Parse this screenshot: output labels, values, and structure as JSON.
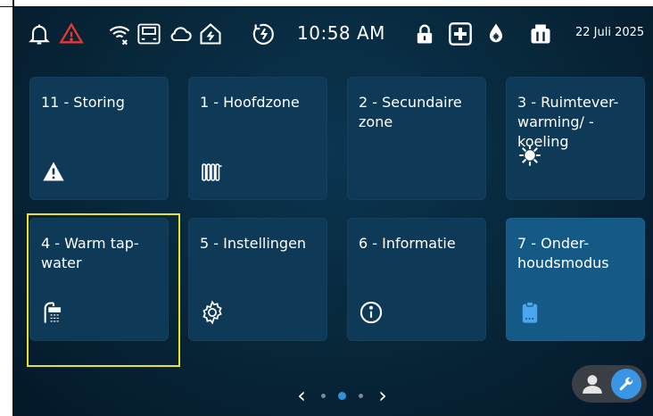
{
  "status_bar": {
    "time": "10:58 AM",
    "date": "22 Juli 2025",
    "icons": [
      "bell-icon",
      "warning-icon",
      "wifi-off-icon",
      "network-port-icon",
      "cloud-icon",
      "home-energy-icon",
      "power-saving-icon",
      "lock-icon",
      "medical-cross-icon",
      "frost-protection-icon",
      "boiler-icon"
    ],
    "warning_color": "#e53935"
  },
  "tiles": [
    {
      "label": "11 - Storing",
      "icon": "warning-icon"
    },
    {
      "label": "1 - Hoofdzone",
      "icon": "radiator-icon"
    },
    {
      "label": "2 - Secundaire zone",
      "icon": ""
    },
    {
      "label": "3 - Ruimtever-warming/ -koeling",
      "icon": "heat-cool-icon"
    },
    {
      "label": "4 - Warm tap-water",
      "icon": "shower-icon"
    },
    {
      "label": "5 - Instellingen",
      "icon": "gear-icon"
    },
    {
      "label": "6 - Informatie",
      "icon": "info-icon"
    },
    {
      "label": "7 - Onder-houdsmodus",
      "icon": "clipboard-icon"
    }
  ],
  "pager": {
    "prev": "‹",
    "next": "›",
    "pages": 3,
    "active_page": 2
  },
  "colors": {
    "accent": "#2f8fe0",
    "highlight": "#e8e32a",
    "tile": "#0e3a58",
    "tile_lit": "#155a86"
  }
}
